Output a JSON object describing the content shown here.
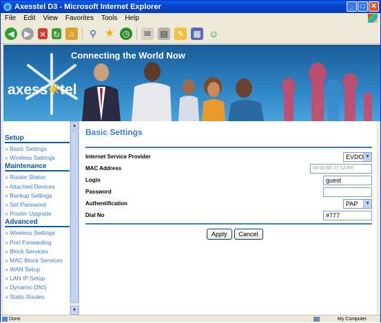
{
  "window": {
    "title": "Axesstel D3 - Microsoft Internet Explorer",
    "buttons": [
      "_",
      "□",
      "✕"
    ]
  },
  "menubar": {
    "items": [
      "File",
      "Edit",
      "View",
      "Favorites",
      "Tools",
      "Help"
    ]
  },
  "banner": {
    "tagline": "Connecting the World Now",
    "logo_part1": "axess",
    "logo_o": "✳",
    "logo_part2": "tel"
  },
  "sidebar": {
    "sections": [
      {
        "heading": "Setup",
        "items": [
          "Basic Settings",
          "Wireless Settings"
        ]
      },
      {
        "heading": "Maintenance",
        "items": [
          "Router Status",
          "Attached Devices",
          "Backup Settings",
          "Set Password",
          "Router Upgrade"
        ]
      },
      {
        "heading": "Advanced",
        "items": [
          "Wireless Settings",
          "Port Forwarding",
          "Block Services",
          "MAC Block Services",
          "WAN Setup",
          "LAN IP Setup",
          "Dynamic DNS",
          "Static Routes"
        ]
      }
    ]
  },
  "main": {
    "title": "Basic Settings",
    "fields": {
      "isp": {
        "label": "Internet Service Provider",
        "value": "EVDO"
      },
      "mac": {
        "label": "MAC Address",
        "value": "00:00:9E:27:1A:EE"
      },
      "login": {
        "label": "Login",
        "value": "guest"
      },
      "password": {
        "label": "Password",
        "value": ""
      },
      "auth": {
        "label": "Authentification",
        "value": "PAP"
      },
      "dial": {
        "label": "Dial No",
        "value": "#777"
      }
    },
    "apply_label": "Apply",
    "cancel_label": "Cancel"
  },
  "status": {
    "left": "Done",
    "zone": "My Computer"
  },
  "colors": {
    "accent": "#3a7dc4",
    "sidebar_heading": "#0a57a4",
    "titlebar": "#0a5fe8"
  }
}
